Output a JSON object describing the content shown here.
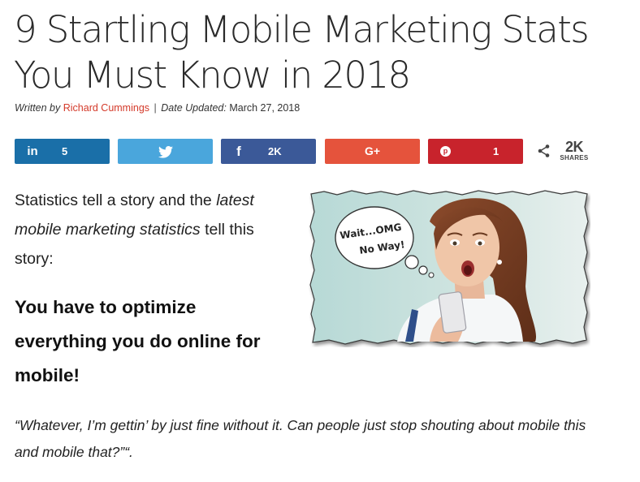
{
  "article": {
    "title": "9 Startling Mobile Marketing Stats You Must Know in 2018",
    "byline": {
      "written_by": "Written by",
      "author": "Richard Cummings",
      "separator": "|",
      "date_label": "Date Updated:",
      "date": "March 27, 2018"
    },
    "intro": {
      "part1": "Statistics tell a story and the ",
      "part2": "latest mobile marketing statistics",
      "part3": " tell this story:"
    },
    "highlight": "You have to optimize everything you do online for mobile!",
    "quote": "“Whatever, I’m gettin’ by just fine without it. Can people just stop shouting about mobile this and mobile that?”“."
  },
  "image": {
    "bubble_line1": "Wait...OMG",
    "bubble_line2": "No Way!"
  },
  "share_bar": {
    "buttons": [
      {
        "network": "linkedin",
        "icon": "in",
        "count": "5"
      },
      {
        "network": "twitter",
        "icon": "twitter-bird",
        "count": ""
      },
      {
        "network": "facebook",
        "icon": "f",
        "count": "2K"
      },
      {
        "network": "google-plus",
        "icon": "G+",
        "count": ""
      },
      {
        "network": "pinterest",
        "icon": "p",
        "count": "1"
      }
    ],
    "total": "2K",
    "total_label": "SHARES"
  },
  "colors": {
    "linkedin": "#1a6fa8",
    "twitter": "#4aa6dc",
    "facebook": "#3b5998",
    "google_plus": "#e5533c",
    "pinterest": "#c8232c",
    "author_link": "#d43a2a"
  }
}
